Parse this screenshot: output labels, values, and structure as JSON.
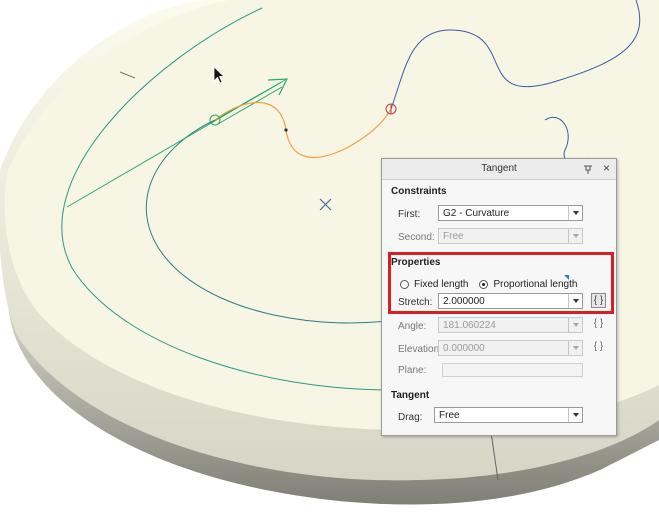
{
  "panel": {
    "title": "Tangent",
    "constraints": {
      "heading": "Constraints",
      "first_label": "First:",
      "first_value": "G2 - Curvature",
      "second_label": "Second:",
      "second_value": "Free"
    },
    "properties": {
      "heading": "Properties",
      "fixed_length_label": "Fixed length",
      "proportional_length_label": "Proportional length",
      "selected_option": "Proportional length",
      "stretch_label": "Stretch:",
      "stretch_value": "2.000000",
      "angle_label": "Angle:",
      "angle_value": "181.060224",
      "elevation_label": "Elevation:",
      "elevation_value": "0.000000",
      "plane_label": "Plane:",
      "plane_value": ""
    },
    "tangent": {
      "heading": "Tangent",
      "drag_label": "Drag:",
      "drag_value": "Free"
    },
    "formula_symbol": "{ }",
    "close_symbol": "×"
  },
  "colors": {
    "highlight_border": "#d81f26",
    "model_top": "#f7f6e4",
    "curve_orange": "#f0a040",
    "curve_blue": "#3a5aa8",
    "sketch_green": "#2aa86a"
  },
  "icons": [
    "cursor-arrow-icon",
    "pin-icon",
    "close-icon",
    "formula-icon",
    "dropdown-arrow-icon",
    "center-mark-icon"
  ]
}
